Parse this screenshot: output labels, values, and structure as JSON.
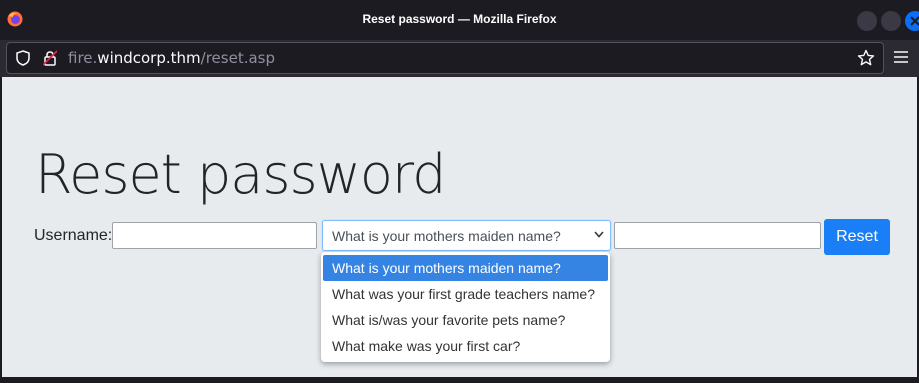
{
  "window": {
    "title": "Reset password — Mozilla Firefox"
  },
  "urlbar": {
    "url_sub": "fire.",
    "url_host": "windcorp.thm",
    "url_path": "/reset.asp"
  },
  "page": {
    "heading": "Reset password",
    "username_label": "Username:",
    "username_value": "",
    "question_selected": "What is your mothers maiden name?",
    "answer_value": "",
    "reset_label": "Reset",
    "question_options": [
      "What is your mothers maiden name?",
      "What was your first grade teachers name?",
      "What is/was your favorite pets name?",
      "What make was your first car?"
    ]
  },
  "colors": {
    "accent": "#1a7ff6",
    "selected_option": "#3584e4",
    "page_bg": "#e8ebee",
    "chrome_bg": "#1c1b22"
  }
}
